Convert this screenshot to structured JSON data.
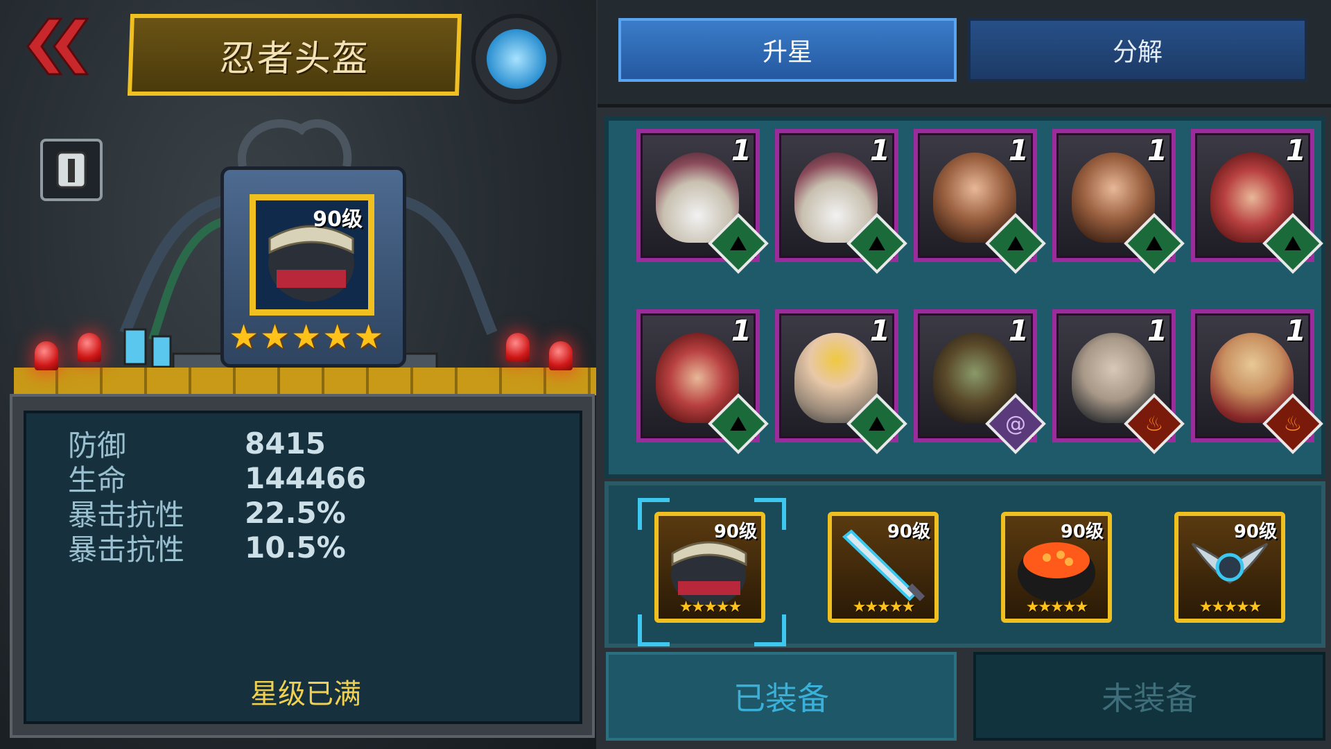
{
  "header": {
    "title": "忍者头盔"
  },
  "item": {
    "level_label": "90级",
    "stars": 5
  },
  "stats": [
    {
      "label": "防御",
      "value": "8415"
    },
    {
      "label": "生命",
      "value": "144466"
    },
    {
      "label": "暴击抗性",
      "value": "22.5%"
    },
    {
      "label": "暴击抗性",
      "value": "10.5%"
    }
  ],
  "star_status": "星级已满",
  "tabs": {
    "upgrade": "升星",
    "decompose": "分解"
  },
  "heroes": [
    {
      "number": "1",
      "faction": "green-peak"
    },
    {
      "number": "1",
      "faction": "green-peak"
    },
    {
      "number": "1",
      "faction": "green-peak"
    },
    {
      "number": "1",
      "faction": "green-peak"
    },
    {
      "number": "1",
      "faction": "green-peak"
    },
    {
      "number": "1",
      "faction": "green-peak"
    },
    {
      "number": "1",
      "faction": "green-peak"
    },
    {
      "number": "1",
      "faction": "purple-swirl"
    },
    {
      "number": "1",
      "faction": "fire"
    },
    {
      "number": "1",
      "faction": "fire"
    }
  ],
  "equipment": [
    {
      "name": "ninja-helmet",
      "level": "90级",
      "stars": "★★★★★"
    },
    {
      "name": "sword",
      "level": "90级",
      "stars": "★★★★★"
    },
    {
      "name": "sushi",
      "level": "90级",
      "stars": "★★★★★"
    },
    {
      "name": "claw-blade",
      "level": "90级",
      "stars": "★★★★★"
    }
  ],
  "bottom_tabs": {
    "equipped": "已装备",
    "unequipped": "未装备"
  },
  "colors": {
    "gold": "#f0c020",
    "hero_border": "#9a2c9c",
    "active_tab": "#3b7cc8"
  }
}
